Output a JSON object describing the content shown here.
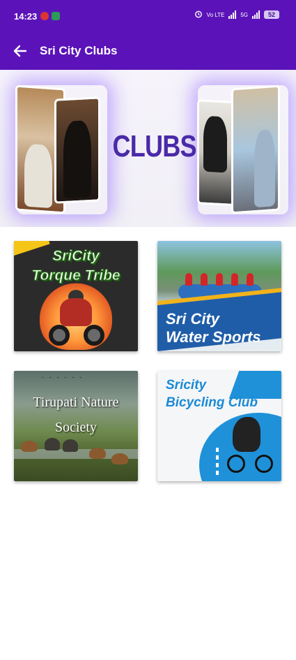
{
  "status_bar": {
    "time": "14:23",
    "sim1": "Jio",
    "sim2": "S",
    "network1": "Vo LTE",
    "network2": "VoLTE",
    "net_type": "5G",
    "battery": "52"
  },
  "app_bar": {
    "title": "Sri City Clubs",
    "back_icon": "arrow-left-icon"
  },
  "banner": {
    "heading": "CLUBS"
  },
  "clubs": [
    {
      "line1": "SriCity",
      "line2": "Torque Tribe"
    },
    {
      "line1": "Sri City",
      "line2": "Water Sports"
    },
    {
      "line1": "Tirupati Nature",
      "line2": "Society"
    },
    {
      "line1": "Sricity",
      "line2": "Bicycling Club"
    }
  ],
  "colors": {
    "app_bar": "#5b13b9",
    "banner_heading": "#4a2aa8",
    "water_sports_banner": "#1f5da8",
    "bicycling_accent": "#1f91d8"
  }
}
